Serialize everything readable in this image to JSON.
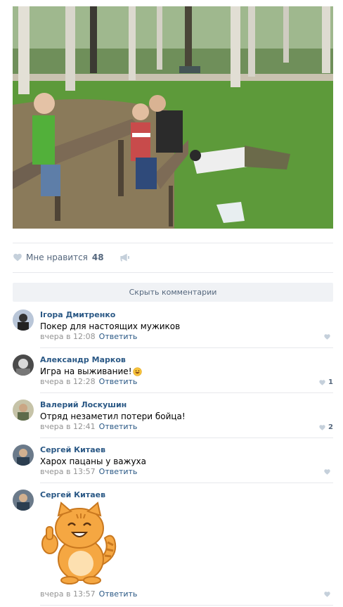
{
  "post": {
    "likes_label": "Мне нравится",
    "likes_count": "48"
  },
  "hide_comments_label": "Скрыть комментарии",
  "comments": [
    {
      "author": "Ігора Дмитренко",
      "text": "Покер для настоящих мужиков",
      "time": "вчера в 12:08",
      "reply": "Ответить",
      "likes": ""
    },
    {
      "author": "Александр Марков",
      "text": "Игра на выживание!",
      "emoji": "grinning-face",
      "time": "вчера в 12:28",
      "reply": "Ответить",
      "likes": "1"
    },
    {
      "author": "Валерий Лоскушин",
      "text": "Отряд незаметил потери бойца!",
      "time": "вчера в 12:41",
      "reply": "Ответить",
      "likes": "2"
    },
    {
      "author": "Сергей Китаев",
      "text": "Харох пацаны у важуха",
      "time": "вчера в 13:57",
      "reply": "Ответить",
      "likes": ""
    },
    {
      "author": "Сергей Китаев",
      "text": "",
      "sticker": "thumbs-up-cat",
      "time": "вчера в 13:57",
      "reply": "Ответить",
      "likes": ""
    }
  ],
  "colors": {
    "link": "#2a5885",
    "meta": "#939393",
    "divider": "#e7e8ec",
    "button_bg": "#f0f2f5",
    "icon": "#c5d0db"
  }
}
